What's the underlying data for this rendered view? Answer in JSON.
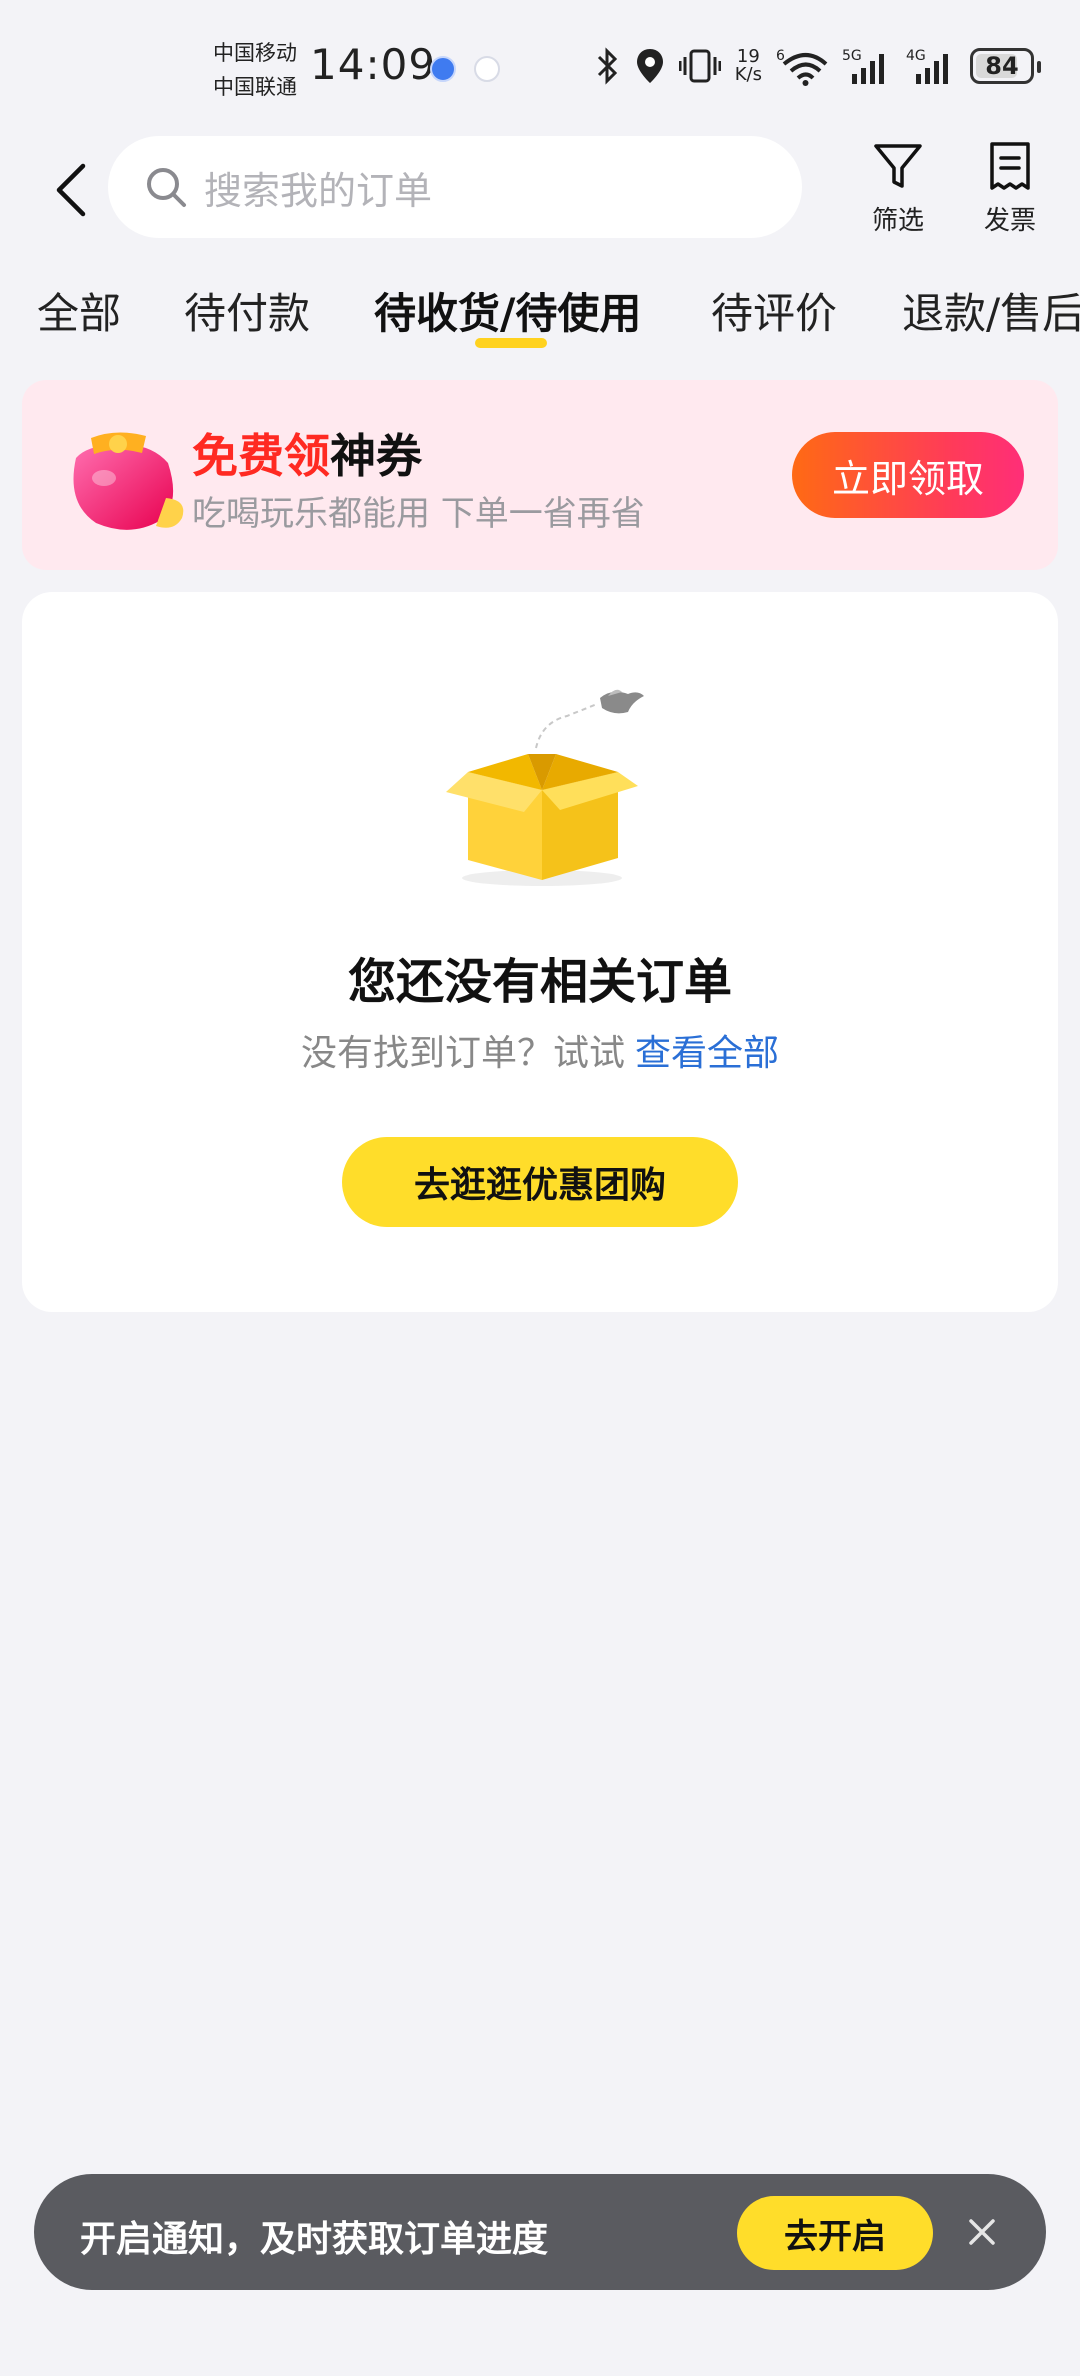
{
  "status_bar": {
    "carrier_1": "中国移动",
    "carrier_2": "中国联通",
    "time": "14:09",
    "speed_value": "19",
    "speed_unit": "K/s",
    "battery": "84"
  },
  "header": {
    "search_placeholder": "搜索我的订单",
    "filter_label": "筛选",
    "invoice_label": "发票"
  },
  "tabs": [
    {
      "label": "全部"
    },
    {
      "label": "待付款"
    },
    {
      "label": "待收货/待使用",
      "active": true
    },
    {
      "label": "待评价"
    },
    {
      "label": "退款/售后"
    }
  ],
  "coupon": {
    "title_highlight": "免费领",
    "title_rest": "神券",
    "subtitle": "吃喝玩乐都能用 下单一省再省",
    "button": "立即领取"
  },
  "empty_state": {
    "title": "您还没有相关订单",
    "hint": "没有找到订单？试试",
    "link": "查看全部",
    "button": "去逛逛优惠团购"
  },
  "notification": {
    "text": "开启通知，及时获取订单进度",
    "button": "去开启"
  },
  "colors": {
    "accent_yellow": "#ffdd2a",
    "coupon_red": "#ff2a22",
    "link_blue": "#2a6fd6"
  }
}
